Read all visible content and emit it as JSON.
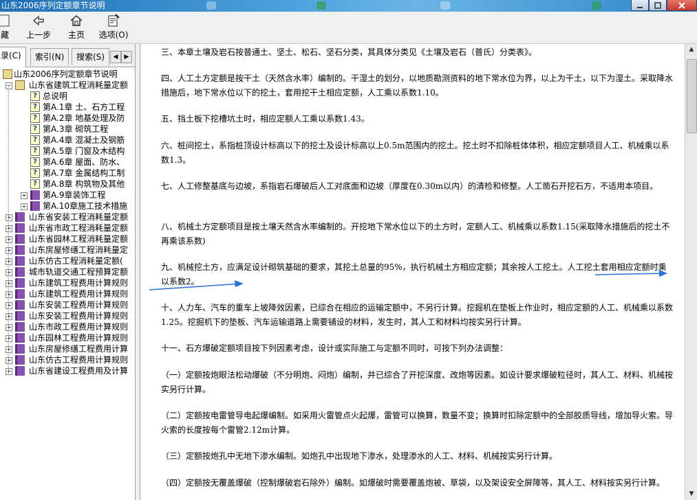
{
  "window": {
    "title": "山东2006序列定额章节说明"
  },
  "toolbar": {
    "buttons": [
      {
        "label": "藏",
        "icon": "favorites-icon"
      },
      {
        "label": "上一步",
        "icon": "back-arrow-icon"
      },
      {
        "label": "主页",
        "icon": "home-icon"
      },
      {
        "label": "选项(O)",
        "icon": "options-icon"
      }
    ]
  },
  "tabs": [
    {
      "label": "录(C)"
    },
    {
      "label": "索引(N)"
    },
    {
      "label": "搜索(S)"
    }
  ],
  "tree": [
    {
      "label": "山东2006序列定额章节说明",
      "level": 0,
      "icon": "book-open",
      "exp": ""
    },
    {
      "label": "山东省建筑工程消耗量定额",
      "level": 1,
      "icon": "book-open",
      "exp": "−"
    },
    {
      "label": "总说明",
      "level": 2,
      "icon": "help",
      "exp": ""
    },
    {
      "label": "第A.1章 土、石方工程",
      "level": 2,
      "icon": "help",
      "exp": ""
    },
    {
      "label": "第A.2章 地基处理及防",
      "level": 2,
      "icon": "help",
      "exp": ""
    },
    {
      "label": "第A.3章 砌筑工程",
      "level": 2,
      "icon": "help",
      "exp": ""
    },
    {
      "label": "第A.4章 混凝土及钢筋",
      "level": 2,
      "icon": "help",
      "exp": ""
    },
    {
      "label": "第A.5章 门窗及木结构",
      "level": 2,
      "icon": "help",
      "exp": ""
    },
    {
      "label": "第A.6章 屋面、防水、",
      "level": 2,
      "icon": "help",
      "exp": ""
    },
    {
      "label": "第A.7章 金属结构工制",
      "level": 2,
      "icon": "help",
      "exp": ""
    },
    {
      "label": "第A.8章 构筑物及其他",
      "level": 2,
      "icon": "help",
      "exp": ""
    },
    {
      "label": "第A.9章装饰工程",
      "level": 2,
      "icon": "book",
      "exp": "+"
    },
    {
      "label": "第A.10章施工技术措施",
      "level": 2,
      "icon": "book",
      "exp": "+"
    },
    {
      "label": "山东省安装工程消耗量定额",
      "level": 1,
      "icon": "book",
      "exp": "+"
    },
    {
      "label": "山东省市政工程消耗量定额",
      "level": 1,
      "icon": "book",
      "exp": "+"
    },
    {
      "label": "山东省园林工程消耗量定额",
      "level": 1,
      "icon": "book",
      "exp": "+"
    },
    {
      "label": "山东房屋修缮工程消耗量定",
      "level": 1,
      "icon": "book",
      "exp": "+"
    },
    {
      "label": "山东仿古工程消耗量定额(",
      "level": 1,
      "icon": "book",
      "exp": "+"
    },
    {
      "label": "城市轨道交通工程预算定额",
      "level": 1,
      "icon": "book",
      "exp": "+"
    },
    {
      "label": "山东建筑工程费用计算规则",
      "level": 1,
      "icon": "book",
      "exp": "+"
    },
    {
      "label": "山东建筑工程费用计算规则",
      "level": 1,
      "icon": "book",
      "exp": "+"
    },
    {
      "label": "山东安装工程费用计算规则",
      "level": 1,
      "icon": "book",
      "exp": "+"
    },
    {
      "label": "山东安装工程费用计算规则",
      "level": 1,
      "icon": "book",
      "exp": "+"
    },
    {
      "label": "山东市政工程费用计算规则",
      "level": 1,
      "icon": "book",
      "exp": "+"
    },
    {
      "label": "山东园林工程费用计算规则",
      "level": 1,
      "icon": "book",
      "exp": "+"
    },
    {
      "label": "山东房屋修缮工程费用计算",
      "level": 1,
      "icon": "book",
      "exp": "+"
    },
    {
      "label": "山东仿古工程费用计算规则",
      "level": 1,
      "icon": "book",
      "exp": "+"
    },
    {
      "label": "山东省建设工程费用及计算",
      "level": 1,
      "icon": "book",
      "exp": "+"
    }
  ],
  "content": {
    "paragraphs": [
      "三、本章土壤及岩石按普通土、坚土、松石、坚石分类，其具体分类见《土壤及岩石（普氏）分类表》。",
      "四、人工土方定额是按干土（天然含水率）编制的。干湿土的划分，以地质勘测资料的地下常水位为界，以上为干土，以下为湿土。采取降水措施后，地下常水位以下的挖土，套用挖干土相应定额，人工乘以系数1.10。",
      "五、挡土板下挖槽坑土时，相应定额人工乘以系数1.43。",
      "六、桩间挖土，系指桩顶设计标高以下的挖土及设计标高以上0.5m范围内的挖土。挖土时不扣除桩体体积，相应定额项目人工、机械乘以系数1.3。",
      "七、人工修整基底与边坡，系指岩石爆破后人工对底面和边坡（厚度在0.30m以内）的清检和修整。人工凿石开挖石方，不适用本项目。",
      "八、机械土方定额项目是按土壤天然含水率编制的。开挖地下常水位以下的土方时，定额人工、机械乘以系数1.15(采取降水措施后的挖土不再乘该系数)",
      "九、机械挖土方，应满足设计砌筑基础的要求，其挖土总量的95%，执行机械土方相应定额；其余按人工挖土。人工挖土套用相应定额时乘以系数2。",
      "十、人力车、汽车的重车上坡降效因素，已综合在相应的运输定额中，不另行计算。挖掘机在垫板上作业时，相应定额的人工、机械乘以系数1.25。挖掘机下的垫板、汽车运输道路上需要铺设的材料，发生时，其人工和材料均按实另行计算。",
      "十一、石方爆破定额项目按下列因素考虑，设计或实际施工与定额不同时，可按下列办法调整：",
      "（一）定额按炮眼法松动爆破（不分明炮、闷炮）编制，并已综合了开挖深度、改炮等因素。如设计要求爆破粒径时，其人工、材料、机械按实另行计算。",
      "（二）定额按电雷管导电起爆编制。如采用火雷管点火起爆，雷管可以换算，数量不变；换算时扣除定额中的全部胶质导线，增加导火索。导火索的长度按每个雷管2.12m计算。",
      "（三）定额按炮孔中无地下渗水编制。如炮孔中出现地下渗水，处理渗水的人工、材料、机械按实另行计算。",
      "（四）定额按无覆盖爆破（控制爆破岩石除外）编制。如爆破时需要覆盖炮被、草袋，以及架设安全屏障等，其人工、材料按实另行计算。"
    ]
  },
  "colors": {
    "annotation_arrow": "#2b6fd8",
    "titlebar": "#3a8ad0"
  }
}
